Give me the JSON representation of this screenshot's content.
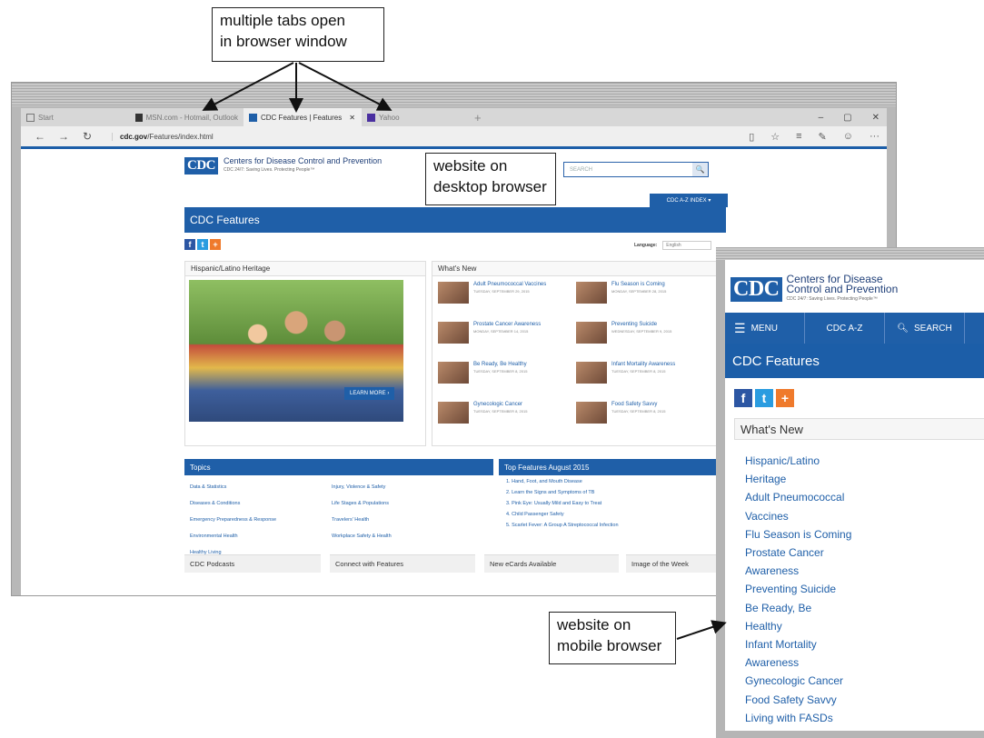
{
  "callouts": {
    "tabs": [
      "multiple tabs open",
      "in browser window"
    ],
    "desktop": [
      "website on",
      "desktop browser"
    ],
    "mobile": [
      "website on",
      "mobile browser"
    ]
  },
  "browser": {
    "tabs": [
      {
        "label": "Start"
      },
      {
        "label": "MSN.com - Hotmail, Outlook"
      },
      {
        "label": "CDC Features | Features",
        "close": "✕"
      },
      {
        "label": "Yahoo"
      }
    ],
    "new_tab": "+",
    "window_controls": [
      "–",
      "▢",
      "✕"
    ],
    "nav": {
      "back": "←",
      "forward": "→",
      "refresh": "↻"
    },
    "url_domain": "cdc.gov",
    "url_path": "/Features/index.html",
    "tools": [
      "▯",
      "☆",
      "≡",
      "✎",
      "☺",
      "···"
    ]
  },
  "desktop": {
    "logo_mark": "CDC",
    "logo_title": "Centers for Disease Control and Prevention",
    "logo_tagline": "CDC 24/7: Saving Lives. Protecting People™",
    "search_placeholder": "SEARCH",
    "search_btn": "🔍",
    "atoz": "CDC A-Z INDEX ▾",
    "features_title": "CDC Features",
    "language_label": "Language:",
    "language_value": "English",
    "hero_heading": "Hispanic/Latino Heritage",
    "learn_more": "LEARN MORE ›",
    "whats_new_heading": "What's New",
    "whats_new": [
      {
        "title": "Adult Pneumococcal Vaccines",
        "date": "TUESDAY, SEPTEMBER 29, 2015"
      },
      {
        "title": "Flu Season is Coming",
        "date": "MONDAY, SEPTEMBER 28, 2015"
      },
      {
        "title": "Prostate Cancer Awareness",
        "date": "MONDAY, SEPTEMBER 14, 2015"
      },
      {
        "title": "Preventing Suicide",
        "date": "WEDNESDAY, SEPTEMBER 9, 2015"
      },
      {
        "title": "Be Ready, Be Healthy",
        "date": "TUESDAY, SEPTEMBER 8, 2015"
      },
      {
        "title": "Infant Mortality Awareness",
        "date": "TUESDAY, SEPTEMBER 8, 2015"
      },
      {
        "title": "Gynecologic Cancer",
        "date": "TUESDAY, SEPTEMBER 8, 2015"
      },
      {
        "title": "Food Safety Savvy",
        "date": "TUESDAY, SEPTEMBER 8, 2015"
      }
    ],
    "topics_heading": "Topics",
    "topics_left": [
      "Data & Statistics",
      "Diseases & Conditions",
      "Emergency Preparedness & Response",
      "Environmental Health",
      "Healthy Living"
    ],
    "topics_right": [
      "Injury, Violence & Safety",
      "Life Stages & Populations",
      "Travelers' Health",
      "Workplace Safety & Health"
    ],
    "top_features_heading": "Top Features August 2015",
    "top_features": [
      "1. Hand, Foot, and Mouth Disease",
      "2. Learn the Signs and Symptoms of TB",
      "3. Pink Eye: Usually Mild and Easy to Treat",
      "4. Child Passenger Safety",
      "5. Scarlet Fever: A Group A Streptococcal Infection"
    ],
    "bottom": [
      "CDC Podcasts",
      "Connect with Features",
      "New eCards Available",
      "Image of the Week"
    ]
  },
  "mobile": {
    "logo_mark": "CDC",
    "logo_line1": "Centers for Disease",
    "logo_line2": "Control and Prevention",
    "logo_tagline": "CDC 24/7: Saving Lives. Protecting People™",
    "menu": "MENU",
    "atoz": "CDC A-Z",
    "search": "SEARCH",
    "features_title": "CDC Features",
    "whats_new_heading": "What's New",
    "links": [
      "Hispanic/Latino",
      "Heritage",
      "Adult Pneumococcal",
      "Vaccines",
      "Flu Season is Coming",
      "Prostate Cancer",
      "Awareness",
      "Preventing Suicide",
      "Be Ready, Be",
      "Healthy",
      "Infant Mortality",
      "Awareness",
      "Gynecologic Cancer",
      "Food Safety Savvy",
      "Living with FASDs"
    ]
  },
  "colors": {
    "cdc_blue": "#1f5fa8",
    "facebook": "#2c56a3",
    "twitter": "#2a9ce0",
    "share": "#ef7a2c"
  }
}
